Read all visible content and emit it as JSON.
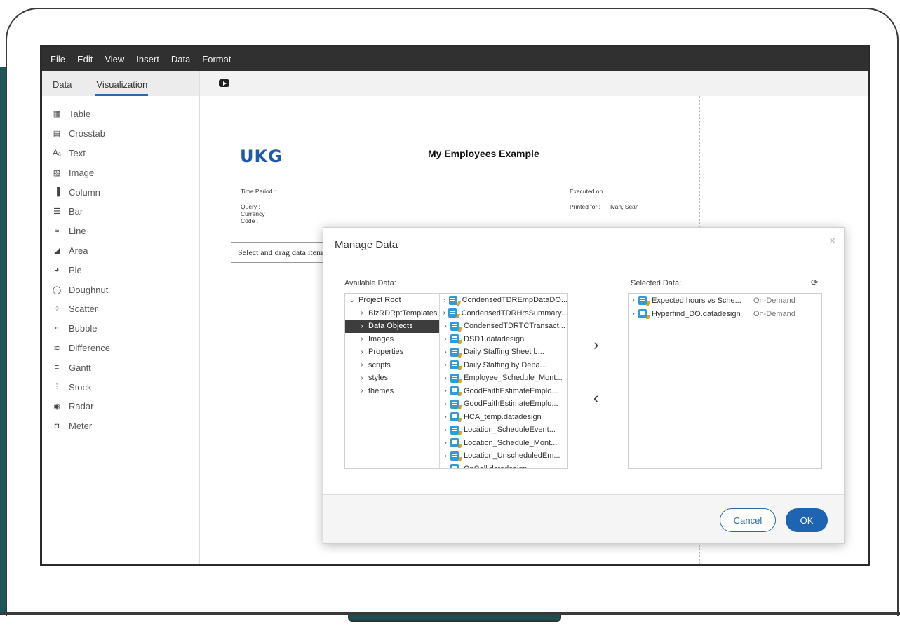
{
  "menu": [
    "File",
    "Edit",
    "View",
    "Insert",
    "Data",
    "Format"
  ],
  "side_tabs": {
    "data": "Data",
    "visualization": "Visualization"
  },
  "viz_items": [
    {
      "label": "Table",
      "icon": "table-icon",
      "glyph": "▦"
    },
    {
      "label": "Crosstab",
      "icon": "crosstab-icon",
      "glyph": "▤"
    },
    {
      "label": "Text",
      "icon": "text-icon",
      "glyph": "Aₐ"
    },
    {
      "label": "Image",
      "icon": "image-icon",
      "glyph": "▨"
    },
    {
      "label": "Column",
      "icon": "column-chart-icon",
      "glyph": "▐"
    },
    {
      "label": "Bar",
      "icon": "bar-chart-icon",
      "glyph": "☰"
    },
    {
      "label": "Line",
      "icon": "line-chart-icon",
      "glyph": "≈"
    },
    {
      "label": "Area",
      "icon": "area-chart-icon",
      "glyph": "◢"
    },
    {
      "label": "Pie",
      "icon": "pie-chart-icon",
      "glyph": "◕"
    },
    {
      "label": "Doughnut",
      "icon": "doughnut-chart-icon",
      "glyph": "◯"
    },
    {
      "label": "Scatter",
      "icon": "scatter-chart-icon",
      "glyph": "⁘"
    },
    {
      "label": "Bubble",
      "icon": "bubble-chart-icon",
      "glyph": "⚬"
    },
    {
      "label": "Difference",
      "icon": "difference-chart-icon",
      "glyph": "≋"
    },
    {
      "label": "Gantt",
      "icon": "gantt-chart-icon",
      "glyph": "≡"
    },
    {
      "label": "Stock",
      "icon": "stock-chart-icon",
      "glyph": "⫶"
    },
    {
      "label": "Radar",
      "icon": "radar-chart-icon",
      "glyph": "◉"
    },
    {
      "label": "Meter",
      "icon": "meter-icon",
      "glyph": "◘"
    }
  ],
  "report": {
    "logo": "UKG",
    "title": "My Employees Example",
    "time_period": "Time Period :",
    "query": "Query :",
    "currency": "Currency",
    "code": "Code :",
    "executed_on": "Executed on",
    "executed_colon": ":",
    "printed_for_label": "Printed for :",
    "printed_for_value": "Ivan, Sean",
    "drop_hint": "Select and drag data items"
  },
  "dialog": {
    "title": "Manage Data",
    "close": "×",
    "available_label": "Available Data:",
    "selected_label": "Selected Data:",
    "refresh_glyph": "⟳",
    "add_arrow": "›",
    "remove_arrow": "‹",
    "tree": [
      {
        "label": "Project Root",
        "chev": "⌄",
        "indent": 0,
        "selected": false
      },
      {
        "label": "BizRDRptTemplates",
        "chev": "›",
        "indent": 1,
        "selected": false
      },
      {
        "label": "Data Objects",
        "chev": "›",
        "indent": 1,
        "selected": true
      },
      {
        "label": "Images",
        "chev": "›",
        "indent": 1,
        "selected": false
      },
      {
        "label": "Properties",
        "chev": "›",
        "indent": 1,
        "selected": false
      },
      {
        "label": "scripts",
        "chev": "›",
        "indent": 1,
        "selected": false
      },
      {
        "label": "styles",
        "chev": "›",
        "indent": 1,
        "selected": false
      },
      {
        "label": "themes",
        "chev": "›",
        "indent": 1,
        "selected": false
      }
    ],
    "files": [
      "CondensedTDREmpDataDO...",
      "CondensedTDRHrsSummary...",
      "CondensedTDRTCTransact...",
      "DSD1.datadesign",
      "Daily Staffing Sheet b...",
      "Daily Staffing by Depa...",
      "Employee_Schedule_Mont...",
      "GoodFaithEstimateEmplo...",
      "GoodFaithEstimateEmplo...",
      "HCA_temp.datadesign",
      "Location_ScheduleEvent...",
      "Location_Schedule_Mont...",
      "Location_UnscheduledEm...",
      "OnCall.datadesign"
    ],
    "selected": [
      {
        "name": "Expected hours vs Sche...",
        "mode": "On-Demand"
      },
      {
        "name": "Hyperfind_DO.datadesign",
        "mode": "On-Demand"
      }
    ],
    "cancel": "Cancel",
    "ok": "OK"
  }
}
